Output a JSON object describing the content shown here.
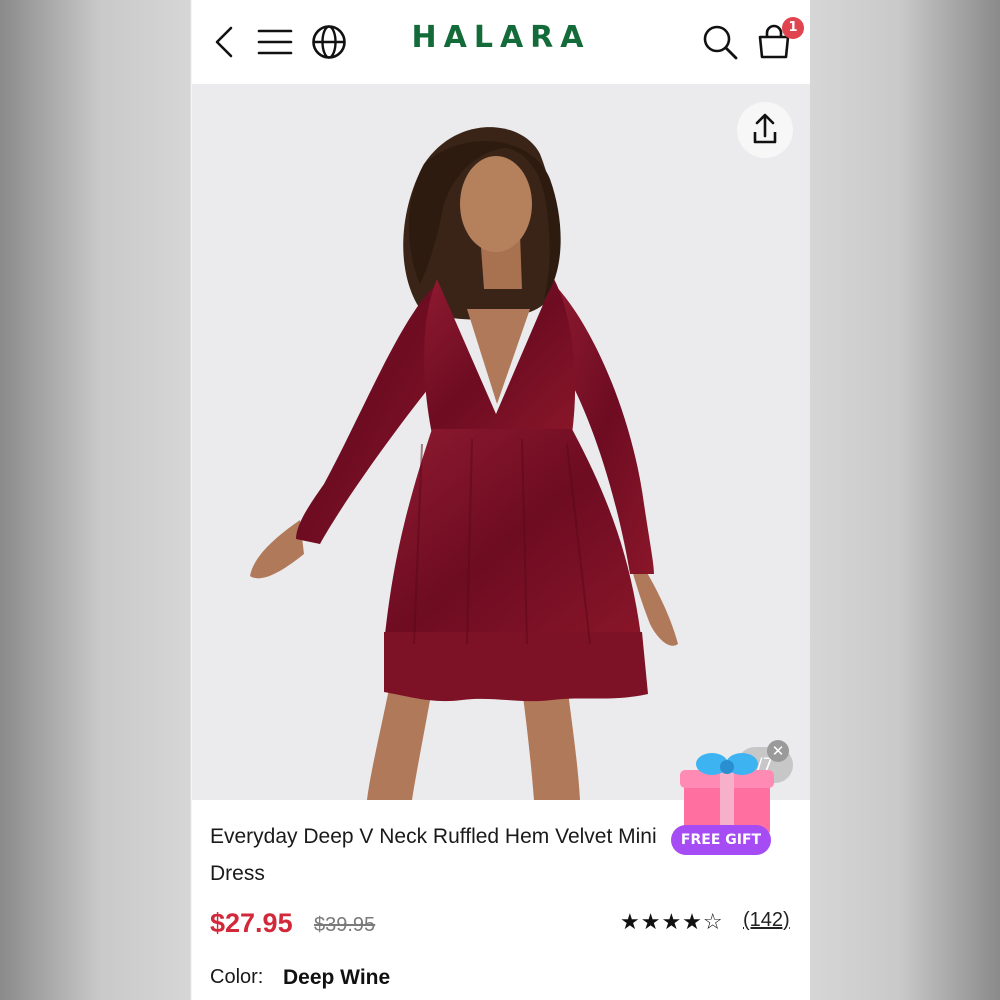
{
  "header": {
    "logo": "HALARA",
    "cart_count": "1",
    "icons": {
      "back": "back-icon",
      "menu": "menu-icon",
      "globe": "globe-icon",
      "search": "search-icon",
      "cart": "cart-icon"
    }
  },
  "gallery": {
    "counter": "/7",
    "share_icon": "share-icon"
  },
  "promo": {
    "label": "FREE GIFT",
    "close": "✕"
  },
  "product": {
    "title": "Everyday Deep V Neck Ruffled Hem Velvet Mini Dress",
    "price": "$27.95",
    "original_price": "$39.95",
    "rating": 4,
    "rating_max": 5,
    "stars": "★★★★☆",
    "review_count": "(142)",
    "color_label": "Color:",
    "color_value": "Deep Wine"
  },
  "colors": {
    "brand": "#146b3a",
    "price": "#d2293a",
    "dress": "#7a1024",
    "badge": "#e0444e",
    "gift_label": "#a64cf5"
  }
}
